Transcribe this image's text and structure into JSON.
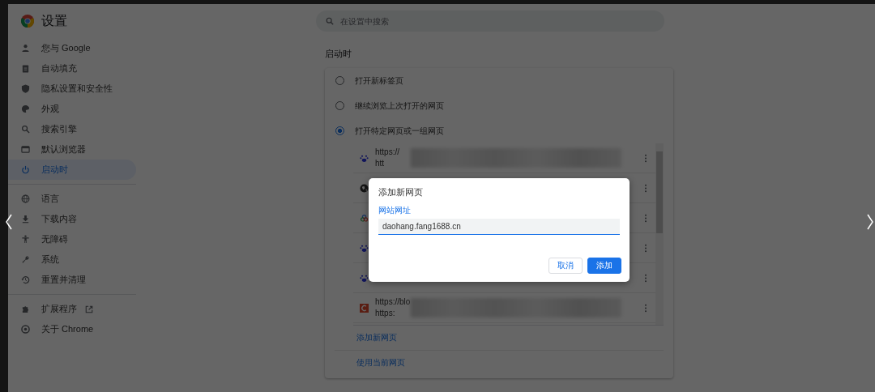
{
  "window": {
    "title": "设置"
  },
  "search": {
    "placeholder": "在设置中搜索"
  },
  "sidebar": {
    "groups": [
      [
        {
          "label": "您与 Google",
          "selected": false
        },
        {
          "label": "自动填充",
          "selected": false
        },
        {
          "label": "隐私设置和安全性",
          "selected": false
        },
        {
          "label": "外观",
          "selected": false
        },
        {
          "label": "搜索引擎",
          "selected": false
        },
        {
          "label": "默认浏览器",
          "selected": false
        },
        {
          "label": "启动时",
          "selected": true
        }
      ],
      [
        {
          "label": "语言",
          "selected": false
        },
        {
          "label": "下载内容",
          "selected": false
        },
        {
          "label": "无障碍",
          "selected": false
        },
        {
          "label": "系统",
          "selected": false
        },
        {
          "label": "重置并清理",
          "selected": false
        }
      ],
      [
        {
          "label": "扩展程序",
          "selected": false,
          "external": true
        },
        {
          "label": "关于 Chrome",
          "selected": false
        }
      ]
    ]
  },
  "startup": {
    "heading": "启动时",
    "options": [
      {
        "label": "打开新标签页",
        "selected": false
      },
      {
        "label": "继续浏览上次打开的网页",
        "selected": false
      },
      {
        "label": "打开特定网页或一组网页",
        "selected": true
      }
    ],
    "pages": [
      {
        "kind": "paw",
        "lines": [
          "https://",
          "htt"
        ],
        "blurred": true
      },
      {
        "kind": "globe"
      },
      {
        "kind": "rings"
      },
      {
        "kind": "paw"
      },
      {
        "kind": "paw"
      },
      {
        "kind": "mark",
        "lines": [
          "https://blo",
          "https:"
        ],
        "blurred": true
      }
    ],
    "links": [
      "添加新网页",
      "使用当前网页"
    ]
  },
  "dialog": {
    "title": "添加新网页",
    "field": {
      "label": "网站网址",
      "value": "daohang.fang1688.cn",
      "focused": true
    },
    "buttons": [
      {
        "label": "取消",
        "kind": "secondary"
      },
      {
        "label": "添加",
        "kind": "primary"
      }
    ]
  }
}
